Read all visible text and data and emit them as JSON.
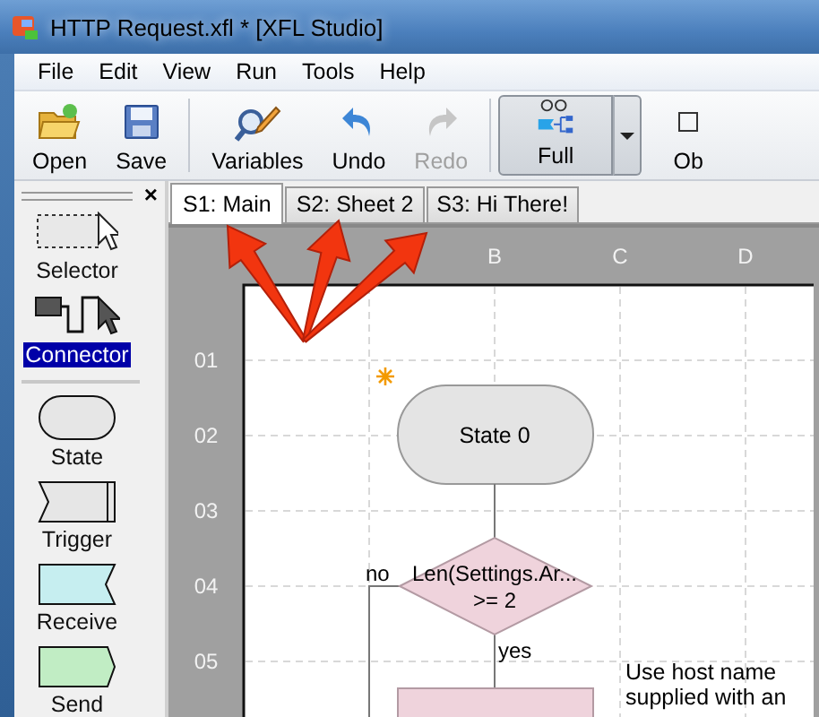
{
  "window": {
    "title": "HTTP Request.xfl * [XFL Studio]"
  },
  "menu": [
    "File",
    "Edit",
    "View",
    "Run",
    "Tools",
    "Help"
  ],
  "toolbar": {
    "groups": [
      [
        {
          "label": "Open",
          "kind": "open",
          "disabled": false,
          "pressed": false
        },
        {
          "label": "Save",
          "kind": "save",
          "disabled": false,
          "pressed": false
        }
      ],
      [
        {
          "label": "Variables",
          "kind": "variables",
          "disabled": false,
          "pressed": false
        },
        {
          "label": "Undo",
          "kind": "undo",
          "disabled": false,
          "pressed": false
        },
        {
          "label": "Redo",
          "kind": "redo",
          "disabled": true,
          "pressed": false
        }
      ],
      [
        {
          "label": "Full",
          "kind": "full",
          "disabled": false,
          "pressed": true,
          "dropdown": true
        },
        {
          "label": "Ob",
          "kind": "object",
          "disabled": false,
          "pressed": false
        }
      ]
    ]
  },
  "palette": {
    "close": "×",
    "tools": [
      {
        "label": "Selector",
        "kind": "selector",
        "selected": false
      },
      {
        "label": "Connector",
        "kind": "connector",
        "selected": true
      }
    ],
    "shapes": [
      {
        "label": "State",
        "kind": "state",
        "selected": false
      },
      {
        "label": "Trigger",
        "kind": "trigger",
        "selected": false
      },
      {
        "label": "Receive",
        "kind": "receive",
        "selected": false
      },
      {
        "label": "Send",
        "kind": "send",
        "selected": false
      }
    ]
  },
  "tabs": [
    {
      "label": "S1: Main",
      "selected": true
    },
    {
      "label": "S2: Sheet 2",
      "selected": false
    },
    {
      "label": "S3: Hi There!",
      "selected": false
    }
  ],
  "sheet": {
    "columns": [
      "B",
      "C",
      "D"
    ],
    "rows": [
      "01",
      "02",
      "03",
      "04",
      "05"
    ],
    "nodes": [
      {
        "kind": "state",
        "label": "State 0",
        "start": true
      },
      {
        "kind": "decision",
        "lines": [
          "Len(Settings.Ar...",
          ">= 2"
        ],
        "no_label": "no",
        "yes_label": "yes"
      },
      {
        "kind": "process"
      }
    ],
    "comment": [
      "Use host name",
      "supplied with an"
    ]
  }
}
